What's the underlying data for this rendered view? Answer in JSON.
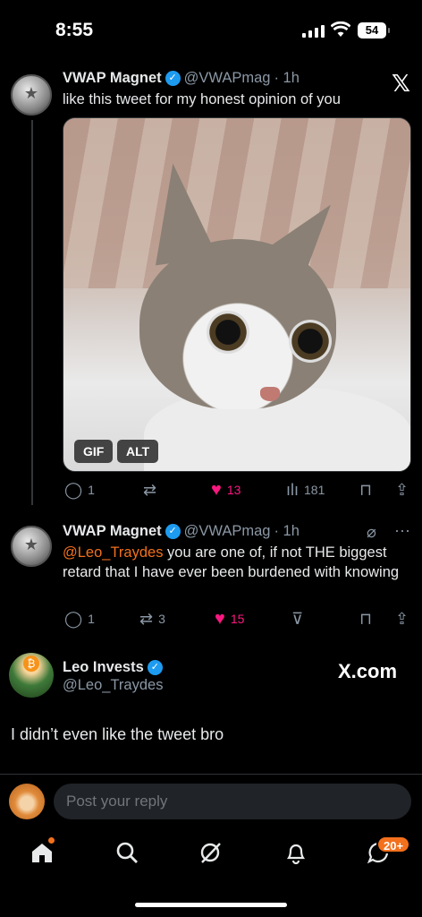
{
  "status_bar": {
    "time": "8:55",
    "battery": "54"
  },
  "tweet1": {
    "author": "VWAP Magnet",
    "handle": "@VWAPmag",
    "time": "· 1h",
    "text": "like this tweet for my honest opinion of you",
    "media_badges": [
      "GIF",
      "ALT"
    ],
    "replies": "1",
    "likes": "13",
    "views": "181"
  },
  "tweet2": {
    "author": "VWAP Magnet",
    "handle": "@VWAPmag",
    "time": "· 1h",
    "mention": "@Leo_Traydes",
    "text": " you are one of, if not THE biggest retard that I have ever been burdened with knowing",
    "replies": "1",
    "retweets": "3",
    "likes": "15"
  },
  "tweet3": {
    "author": "Leo Invests",
    "handle": "@Leo_Traydes",
    "text": "I didn’t even like the tweet bro",
    "brand": "X.com"
  },
  "reply": {
    "placeholder": "Post your reply"
  },
  "tabbar": {
    "notifications": "20+"
  },
  "colors": {
    "accent": "#1d9bf0",
    "like": "#f91880",
    "mention": "#f3701c",
    "background": "#000000"
  }
}
